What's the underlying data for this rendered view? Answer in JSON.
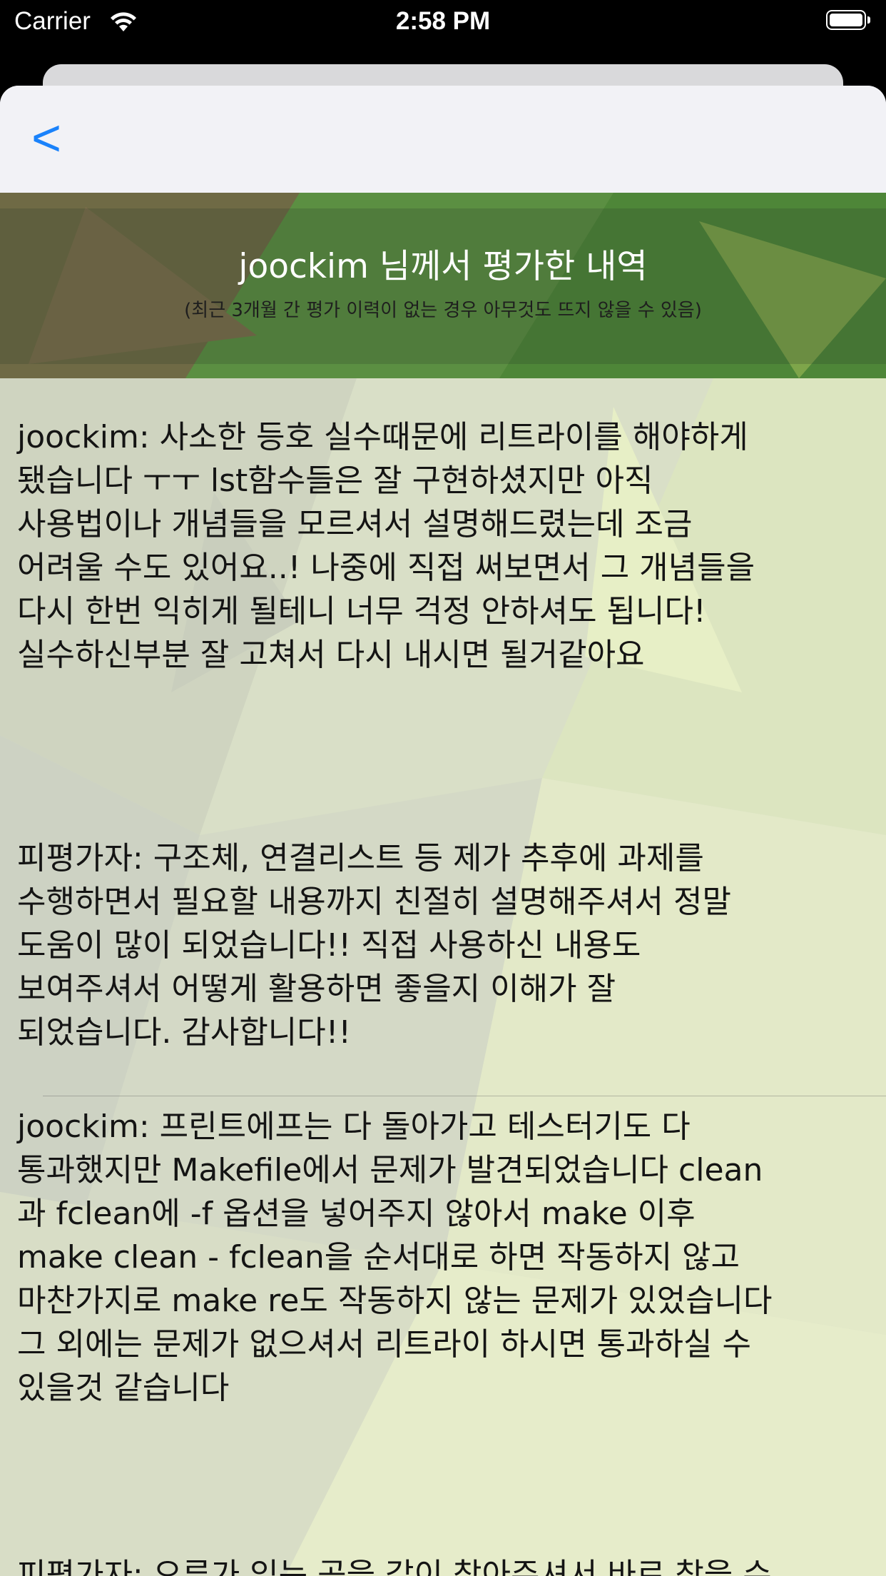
{
  "status_bar": {
    "carrier": "Carrier",
    "time": "2:58 PM"
  },
  "nav": {
    "back_label": "<"
  },
  "header": {
    "title": "joockim 님께서 평가한 내역",
    "subtitle": "(최근 3개월 간 평가 이력이 없는 경우 아무것도 뜨지 않을 수 있음)"
  },
  "reviews": [
    {
      "evaluator_text": "joockim:  사소한 등호 실수때문에 리트라이를 해야하게\n됐습니다 ㅜㅜ lst함수들은 잘 구현하셨지만 아직\n사용법이나 개념들을 모르셔서 설명해드렸는데 조금\n어려울 수도 있어요..! 나중에 직접 써보면서 그 개념들을\n다시 한번 익히게 될테니 너무 걱정 안하셔도 됩니다!\n실수하신부분 잘 고쳐서 다시 내시면 될거같아요",
      "evaluatee_text": "피평가자:  구조체, 연결리스트 등 제가 추후에 과제를\n수행하면서 필요할 내용까지 친절히 설명해주셔서 정말\n도움이 많이 되었습니다!! 직접 사용하신 내용도\n보여주셔서 어떻게 활용하면 좋을지 이해가 잘\n되었습니다. 감사합니다!!"
    },
    {
      "evaluator_text": "joockim:  프린트에프는 다 돌아가고 테스터기도 다\n통과했지만 Makefile에서 문제가 발견되었습니다 clean\n과 fclean에 -f 옵션을 넣어주지 않아서 make 이후\nmake clean - fclean을 순서대로 하면 작동하지 않고\n마찬가지로 make re도 작동하지 않는 문제가 있었습니다\n그 외에는 문제가 없으셔서 리트라이 하시면 통과하실 수\n있을것 같습니다",
      "evaluatee_text": "피평가자:  오류가 있는 곳을 같이 찾아주셔서 바로 찾을 수"
    }
  ],
  "colors": {
    "accent": "#1a82fb",
    "nav_background": "#f2f2f6",
    "text": "#141414"
  }
}
